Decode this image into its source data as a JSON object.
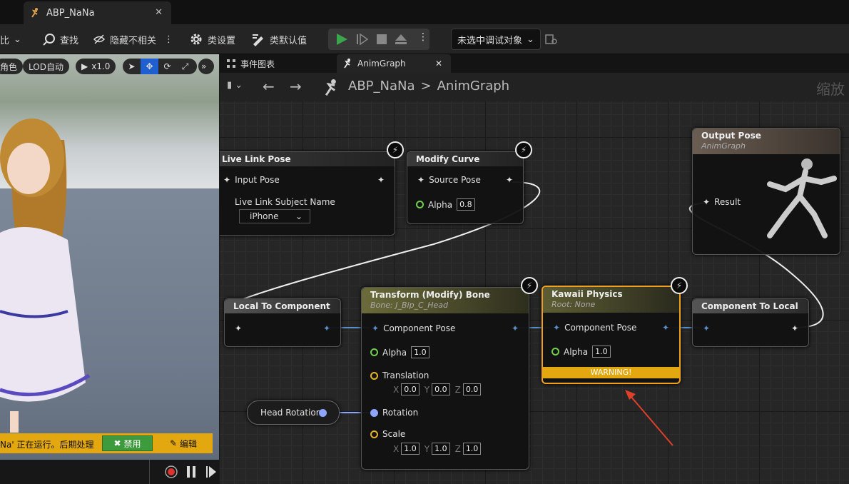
{
  "window": {
    "tab_title": "ABP_NaNa"
  },
  "toolbar": {
    "left_cut_label": "比",
    "find_label": "查找",
    "hide_unrelated_label": "隐藏不相关",
    "class_settings_label": "类设置",
    "class_defaults_label": "类默认值",
    "debug_object_label": "未选中调试对象"
  },
  "viewport": {
    "btn_color_partial": "角色",
    "lod_label": "LOD自动",
    "speed_label": "x1.0",
    "status_text": "Na' 正在运行。后期处理",
    "disable_label": "禁用",
    "edit_label": "编辑"
  },
  "graph_tabs": [
    {
      "label": "事件图表"
    },
    {
      "label": "AnimGraph"
    }
  ],
  "breadcrumb": {
    "root": "ABP_NaNa",
    "sep": ">",
    "current": "AnimGraph",
    "zoom_partial": "缩放"
  },
  "nodes": {
    "live_link": {
      "title": "Live Link Pose",
      "input_pose": "Input Pose",
      "subject_label": "Live Link Subject Name",
      "subject_value": "iPhone"
    },
    "modify_curve": {
      "title": "Modify Curve",
      "source_pose": "Source Pose",
      "alpha_label": "Alpha",
      "alpha": "0.8"
    },
    "output_pose": {
      "title": "Output Pose",
      "subtitle": "AnimGraph",
      "result": "Result"
    },
    "local_to_component": {
      "title": "Local To Component"
    },
    "transform_bone": {
      "title": "Transform (Modify) Bone",
      "subtitle": "Bone: J_Bip_C_Head",
      "component_pose": "Component Pose",
      "alpha_label": "Alpha",
      "alpha": "1.0",
      "translation_label": "Translation",
      "tx": "0.0",
      "ty": "0.0",
      "tz": "0.0",
      "rotation_label": "Rotation",
      "scale_label": "Scale",
      "sx": "1.0",
      "sy": "1.0",
      "sz": "1.0"
    },
    "kawaii": {
      "title": "Kawaii Physics",
      "subtitle": "Root: None",
      "component_pose": "Component Pose",
      "alpha_label": "Alpha",
      "alpha": "1.0",
      "warning": "WARNING!"
    },
    "component_to_local": {
      "title": "Component To Local"
    },
    "head_rotation": {
      "title": "Head Rotation"
    }
  },
  "axis_labels": {
    "x": "X",
    "y": "Y",
    "z": "Z"
  },
  "colors": {
    "accent_green": "#3aa54a",
    "warning": "#e3a70f",
    "selected_border": "#f0a020",
    "annotation_arrow": "#e0402a"
  }
}
